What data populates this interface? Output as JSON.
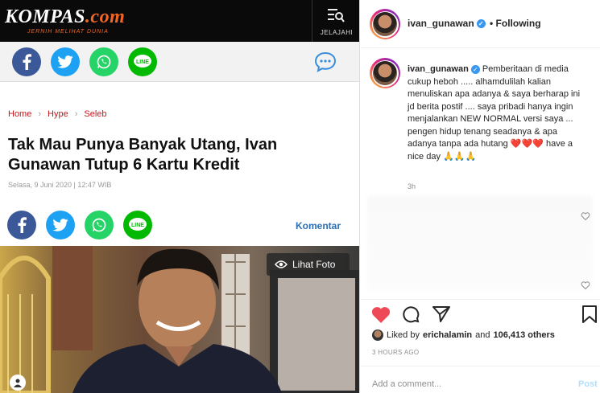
{
  "kompas": {
    "logo_main": "KOMPAS",
    "logo_suffix": ".com",
    "tagline": "JERNIH MELIHAT DUNIA",
    "menu_label": "JELAJAHI",
    "breadcrumb": [
      "Home",
      "Hype",
      "Seleb"
    ],
    "title": "Tak Mau Punya Banyak Utang, Ivan Gunawan Tutup 6 Kartu Kredit",
    "date": "Selasa, 9 Juni 2020 | 12:47 WIB",
    "komentar": "Komentar",
    "lihat_foto": "Lihat Foto",
    "colors": {
      "brand_orange": "#f26522",
      "link_red": "#c4171d"
    }
  },
  "instagram": {
    "username": "ivan_gunawan",
    "follow_status": "• Following",
    "caption": "Pemberitaan di media cukup heboh ..... alhamdulilah kalian menuliskan apa adanya & saya berharap ini jd berita postif .... saya pribadi hanya ingin menjalankan NEW NORMAL versi saya ... pengen hidup tenang seadanya & apa adanya tanpa ada hutang",
    "caption_emoji_tail": "❤️❤️❤️",
    "caption_end": "have a nice day",
    "caption_pray": "🙏🙏🙏",
    "caption_time": "3h",
    "liked_by_prefix": "Liked by",
    "liked_by_user": "erichalamin",
    "liked_by_and": "and",
    "liked_by_count": "106,413 others",
    "time_ago": "3 HOURS AGO",
    "comment_placeholder": "Add a comment...",
    "post_button": "Post"
  }
}
